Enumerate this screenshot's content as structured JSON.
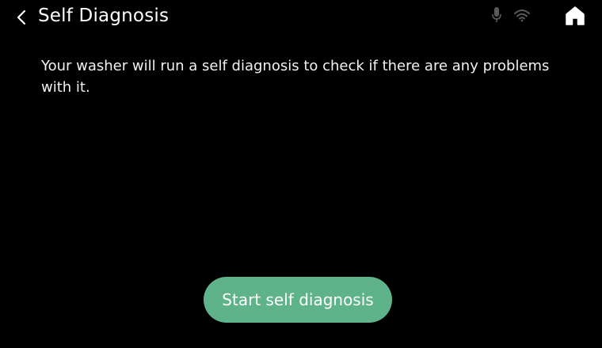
{
  "header": {
    "title": "Self Diagnosis",
    "back_icon": "chevron-left-icon",
    "home_icon": "home-icon"
  },
  "status": {
    "icons": [
      "microphone-icon",
      "wifi-icon"
    ]
  },
  "main": {
    "description": "Your washer will run a self diagnosis to check if there are any problems with it."
  },
  "actions": {
    "start_label": "Start self diagnosis"
  },
  "colors": {
    "background": "#000000",
    "primary_button": "#5fb38b",
    "text": "#ffffff",
    "inactive_icon": "#5a5a5a"
  }
}
